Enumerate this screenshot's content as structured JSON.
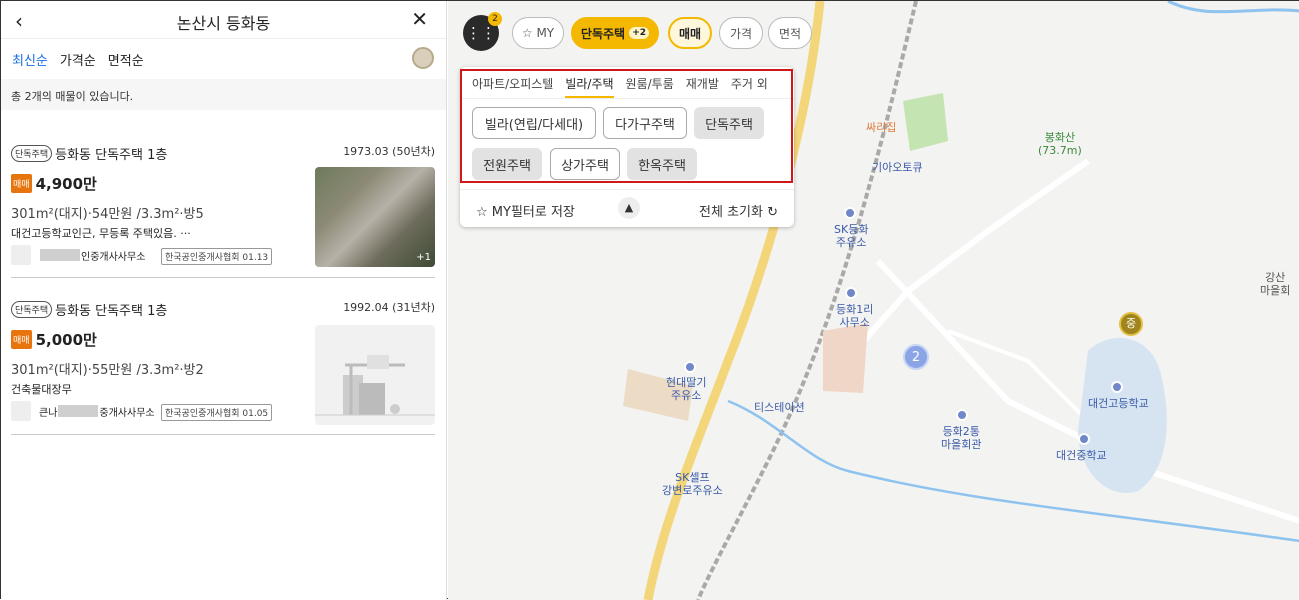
{
  "left": {
    "back_icon": "chevron-left-icon",
    "title": "논산시 등화동",
    "close_icon": "close-icon",
    "sorts": [
      "최신순",
      "가격순",
      "면적순"
    ],
    "count_text": "총 2개의 매물이 있습니다.",
    "items": [
      {
        "tag": "단독주택",
        "name": "등화동 단독주택 1층",
        "year": "1973.03 (50년차)",
        "deal": "매매",
        "price": "4,900만",
        "spec": "301m²(대지)·54만원 /3.3m²·방5",
        "desc": "대건고등학교인근, 무등록 주택있음. ···",
        "agent_prefix": "",
        "agent_suffix": "인중개사사무소",
        "assoc": "한국공인중개사협회 01.13",
        "photo_count": "+1"
      },
      {
        "tag": "단독주택",
        "name": "등화동 단독주택 1층",
        "year": "1992.04 (31년차)",
        "deal": "매매",
        "price": "5,000만",
        "spec": "301m²(대지)·55만원 /3.3m²·방2",
        "desc": "건축물대장무",
        "agent_prefix": "큰나",
        "agent_suffix": "중개사사무소",
        "assoc": "한국공인중개사협회 01.05"
      }
    ]
  },
  "map": {
    "filter_badge": "2",
    "chips": {
      "my": "MY",
      "type": "단독주택",
      "type_more": "+2",
      "deal": "매매",
      "price": "가격",
      "area": "면적"
    },
    "tabs": [
      "아파트/오피스텔",
      "빌라/주택",
      "원룸/투룸",
      "재개발",
      "주거 외"
    ],
    "options": [
      {
        "label": "빌라(연립/다세대)",
        "selected": false
      },
      {
        "label": "다가구주택",
        "selected": false
      },
      {
        "label": "단독주택",
        "selected": true
      },
      {
        "label": "전원주택",
        "selected": true
      },
      {
        "label": "상가주택",
        "selected": false
      },
      {
        "label": "한옥주택",
        "selected": true
      }
    ],
    "save_label": "MY필터로 저장",
    "reset_label": "전체 초기화",
    "labels": {
      "ssarijip": "싸리집",
      "giao": "기아오토큐",
      "sk_donghwa": "SK등화\n주유소",
      "donghwa1": "등화1리\n사무소",
      "hyundai": "현대딸기\n주유소",
      "tistation": "티스테이션",
      "sk_self": "SK셀프\n강변로주유소",
      "donghwa2": "등화2통\n마을회관",
      "bonghwasan": "봉화산\n(73.7m)",
      "daegun_high": "대건고등학교",
      "daegun_mid": "대건중학교",
      "gangsan": "강산\n마을회",
      "middle_badge": "중"
    },
    "cluster_count": "2"
  },
  "colors": {
    "accent": "#f5b800",
    "link": "#1a6ee6",
    "deal": "#e8740e",
    "highlight": "#d01818"
  }
}
